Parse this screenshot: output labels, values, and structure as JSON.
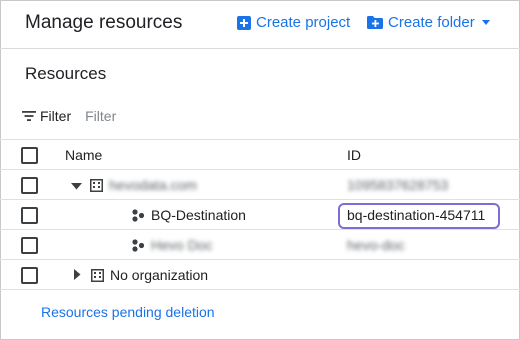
{
  "header": {
    "title": "Manage resources",
    "create_project_label": "Create project",
    "create_folder_label": "Create folder"
  },
  "resources": {
    "title": "Resources",
    "filter_label": "Filter",
    "filter_placeholder": "Filter"
  },
  "table": {
    "columns": {
      "name": "Name",
      "id": "ID"
    },
    "rows": [
      {
        "name": "hevodata.com",
        "id": "1095837628753",
        "icon": "organization-icon",
        "expanded": true
      },
      {
        "name": "BQ-Destination",
        "id": "bq-destination-454711",
        "icon": "project-icon"
      },
      {
        "name": "Hevo Doc",
        "id": "hevo-doc",
        "icon": "project-icon"
      },
      {
        "name": "No organization",
        "id": "",
        "icon": "organization-icon",
        "expanded": false
      }
    ]
  },
  "footer": {
    "pending_deletion_label": "Resources pending deletion"
  },
  "colors": {
    "accent": "#1a73e8",
    "highlight": "#7b6fd6"
  }
}
